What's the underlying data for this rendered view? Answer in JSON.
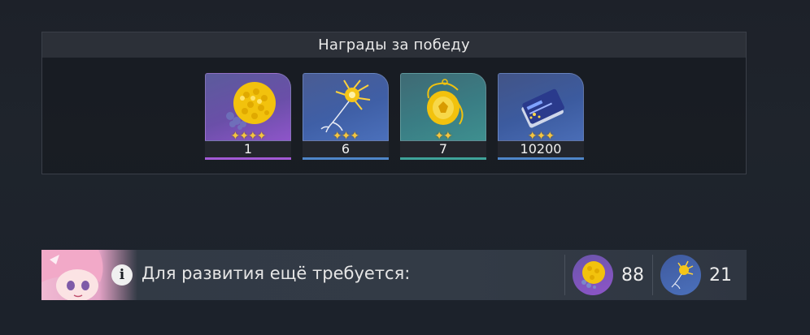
{
  "rewards": {
    "title": "Награды за победу",
    "items": [
      {
        "name": "cluster-item",
        "count": "1",
        "stars": "✦✦✦✦",
        "rarity_color": "#a35ad6"
      },
      {
        "name": "neuron-item",
        "count": "6",
        "stars": "✦✦✦",
        "rarity_color": "#4f86c9"
      },
      {
        "name": "seed-item",
        "count": "7",
        "stars": "✦✦",
        "rarity_color": "#3fa39a"
      },
      {
        "name": "credit-card-item",
        "count": "10200",
        "stars": "✦✦✦",
        "rarity_color": "#4f86c9"
      }
    ]
  },
  "requirement": {
    "info_icon": "i",
    "text": "Для развития ещё требуется:",
    "materials": [
      {
        "icon": "cluster-icon",
        "count": "88"
      },
      {
        "icon": "neuron-icon",
        "count": "21"
      }
    ]
  }
}
